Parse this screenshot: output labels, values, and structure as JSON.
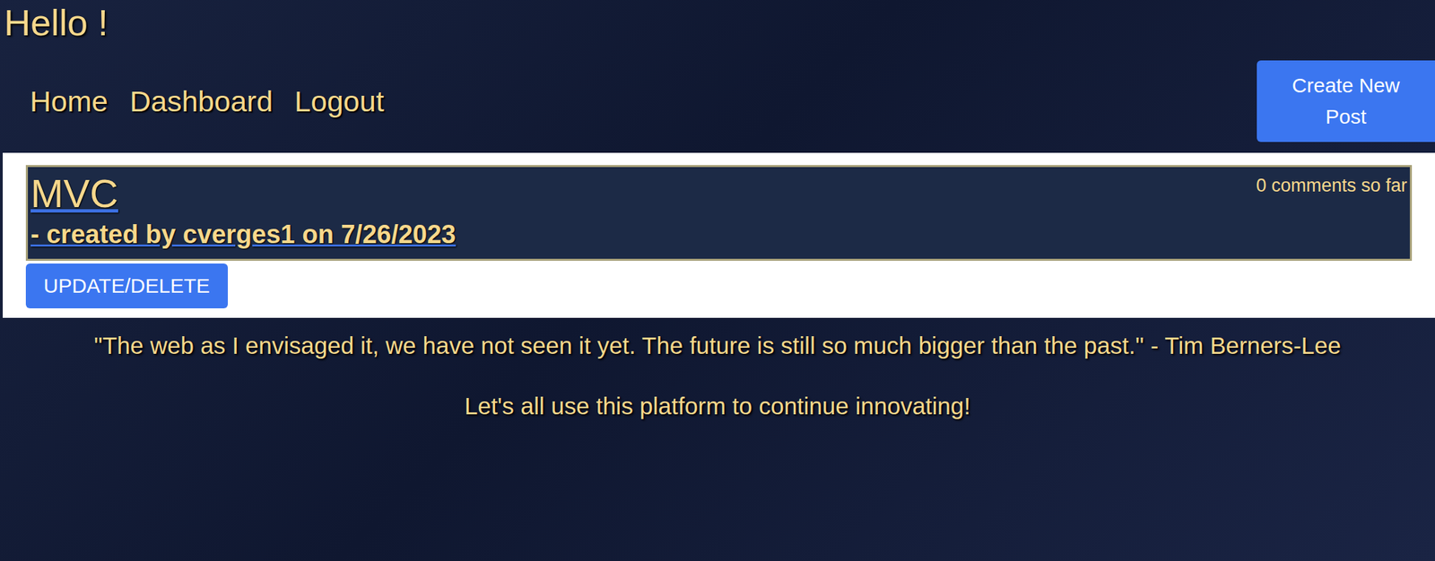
{
  "header": {
    "greeting": "Hello !"
  },
  "nav": [
    {
      "label": "Home"
    },
    {
      "label": "Dashboard"
    },
    {
      "label": "Logout"
    }
  ],
  "create_button": "Create New Post",
  "posts": [
    {
      "title": "MVC",
      "byline": "- created by cverges1 on 7/26/2023",
      "comments": "0 comments so far",
      "action": "UPDATE/DELETE"
    }
  ],
  "footer": {
    "quote": "\"The web as I envisaged it, we have not seen it yet. The future is still so much bigger than the past.\" - Tim Berners-Lee",
    "message": "Let's all use this platform to continue innovating!"
  }
}
